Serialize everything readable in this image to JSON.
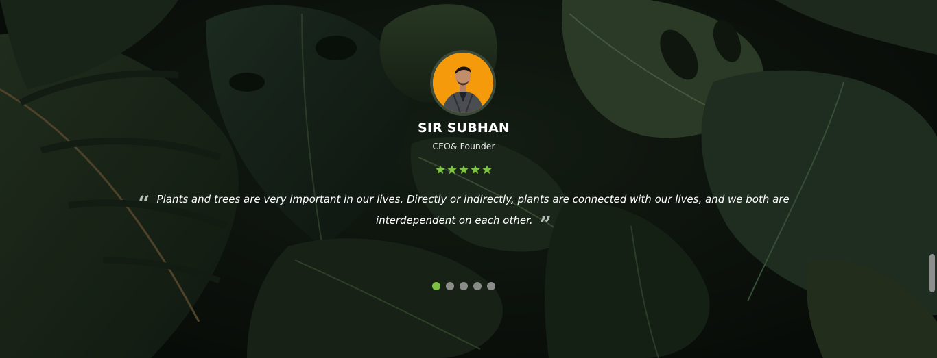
{
  "testimonial": {
    "name": "SIR SUBHAN",
    "role": "CEO& Founder",
    "rating": 5,
    "rating_max": 5,
    "quote": "Plants and trees are very important in our lives. Directly or indirectly, plants are connected with our lives, and we both are interdependent on each other."
  },
  "carousel": {
    "slides_count": 5,
    "active_index": 0
  },
  "colors": {
    "accent": "#7dc242",
    "avatar_bg": "#f59a0a",
    "text": "#ffffff",
    "dot_inactive": "#8a8c8a"
  },
  "icons": {
    "quote_open": "quote-open-icon",
    "quote_close": "quote-close-icon",
    "star": "star-icon"
  }
}
